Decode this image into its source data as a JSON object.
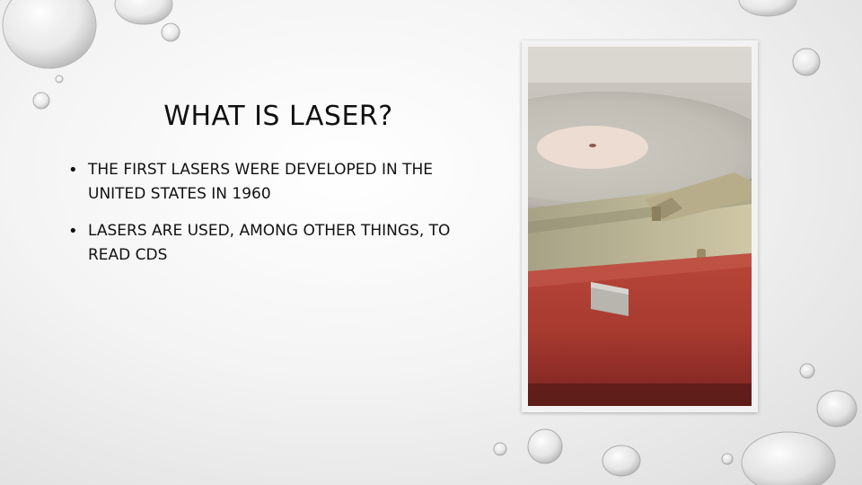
{
  "slide": {
    "title": "What is laser?",
    "bullets": [
      "The first lasers were developed in the United States in 1960",
      "Lasers are used, among other things, to read CDs"
    ]
  },
  "photo": {
    "subject": "record-player-photo",
    "colors": {
      "case_red": "#a83a30",
      "platter": "#c7c3bb",
      "label": "#eddcd2",
      "tonearm": "#b7ad8a"
    }
  },
  "decor": {
    "icon": "water-droplet-icon"
  }
}
